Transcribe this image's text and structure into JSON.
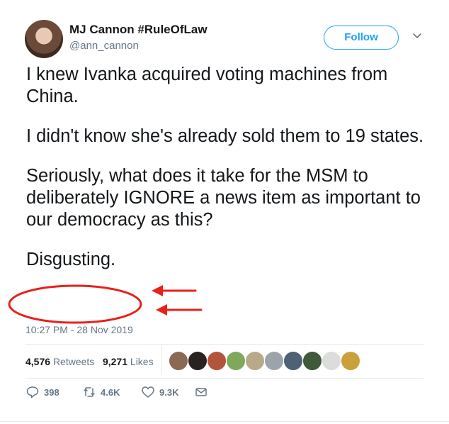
{
  "author": {
    "name": "MJ Cannon #RuleOfLaw",
    "handle": "@ann_cannon"
  },
  "follow_label": "Follow",
  "tweet": {
    "paragraphs": [
      "I knew Ivanka acquired voting machines from China.",
      "I didn't know she's already sold them to 19 states.",
      "Seriously, what does it take for the MSM to deliberately IGNORE a news item as important to our democracy as this?",
      "Disgusting."
    ],
    "timestamp": "10:27 PM - 28 Nov 2019"
  },
  "stats": {
    "retweets_count": "4,576",
    "retweets_label": "Retweets",
    "likes_count": "9,271",
    "likes_label": "Likes"
  },
  "actions": {
    "reply_count": "398",
    "retweet_count": "4.6K",
    "like_count": "9.3K"
  },
  "icons": [
    "chevron-down-icon",
    "reply-icon",
    "retweet-icon",
    "heart-icon",
    "mail-icon"
  ],
  "colors": {
    "accent": "#1da1f2",
    "secondary_text": "#657786",
    "annotation": "#e8211b"
  }
}
